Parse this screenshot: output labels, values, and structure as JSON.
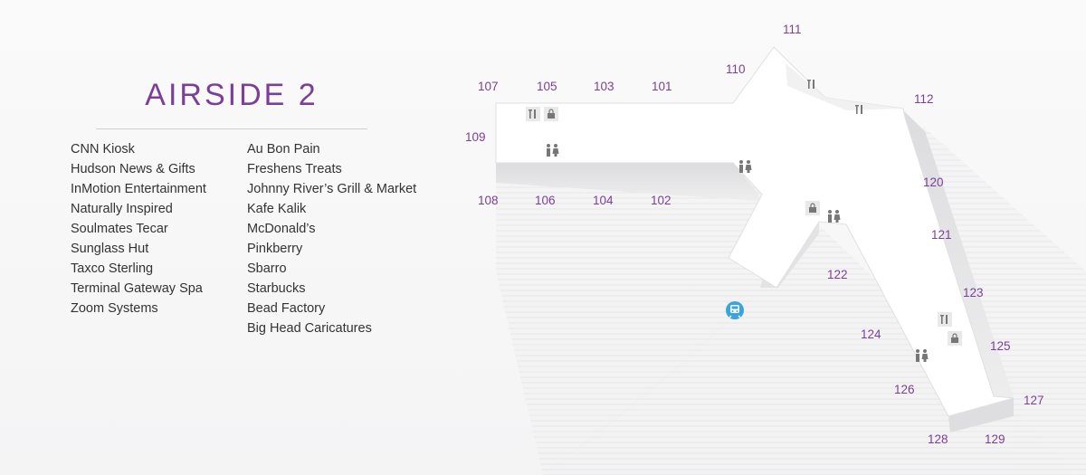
{
  "title": "AIRSIDE 2",
  "directory": {
    "column1": [
      "CNN Kiosk",
      "Hudson News & Gifts",
      "InMotion Entertainment",
      "Naturally Inspired",
      "Soulmates Tecar",
      "Sunglass Hut",
      "Taxco Sterling",
      "Terminal Gateway Spa",
      "Zoom Systems"
    ],
    "column2": [
      "Au Bon Pain",
      "Freshens Treats",
      "Johnny River’s Grill & Market",
      "Kafe Kalik",
      "McDonald’s",
      "Pinkberry",
      "Sbarro",
      "Starbucks",
      "Bead Factory",
      "Big Head Caricatures"
    ]
  },
  "gates": [
    "101",
    "102",
    "103",
    "104",
    "105",
    "106",
    "107",
    "108",
    "109",
    "110",
    "111",
    "112",
    "120",
    "121",
    "122",
    "123",
    "124",
    "125",
    "126",
    "127",
    "128",
    "129"
  ],
  "icons": {
    "dining": "fork-knife-icon",
    "shopping": "shopping-bag-icon",
    "restroom": "restroom-icon",
    "tram": "tram-icon"
  },
  "colors": {
    "accent": "#7b3f98",
    "tram": "#3aa5dd",
    "text": "#333333"
  }
}
